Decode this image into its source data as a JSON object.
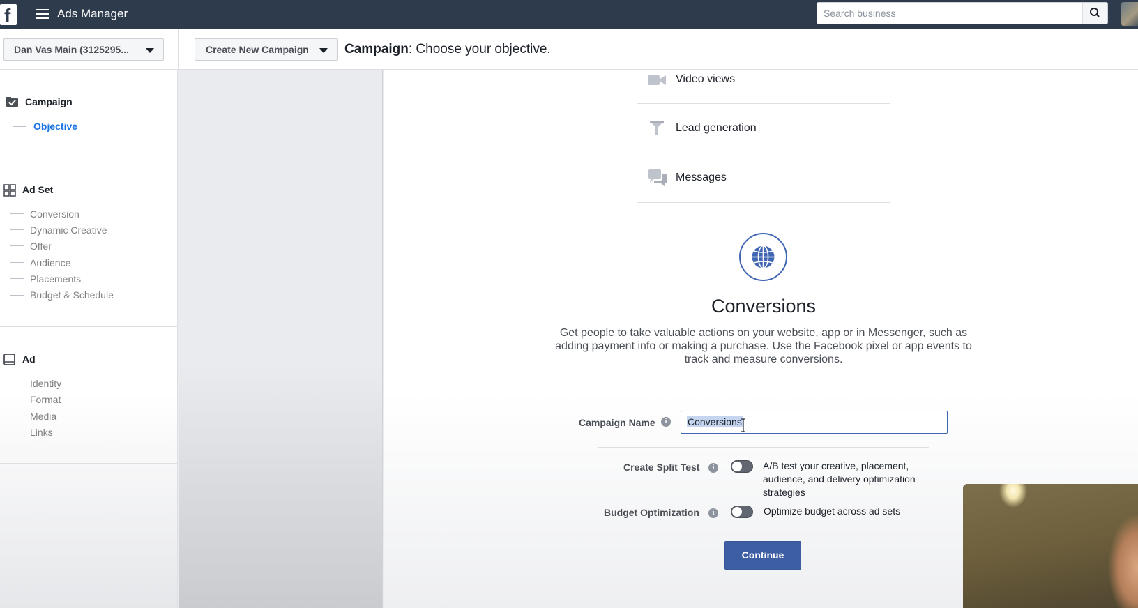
{
  "topbar": {
    "logo": "f",
    "app_title": "Ads Manager",
    "search_placeholder": "Search business"
  },
  "subheader": {
    "account": "Dan Vas Main (3125295...",
    "create_button": "Create New Campaign",
    "title_bold": "Campaign",
    "title_rest": ": Choose your objective."
  },
  "sidebar": {
    "campaign": {
      "title": "Campaign",
      "items": [
        "Objective"
      ]
    },
    "adset": {
      "title": "Ad Set",
      "items": [
        "Conversion",
        "Dynamic Creative",
        "Offer",
        "Audience",
        "Placements",
        "Budget & Schedule"
      ]
    },
    "ad": {
      "title": "Ad",
      "items": [
        "Identity",
        "Format",
        "Media",
        "Links"
      ]
    }
  },
  "objectives": [
    {
      "label": "Video views",
      "icon": "video-camera-icon"
    },
    {
      "label": "Lead generation",
      "icon": "funnel-icon"
    },
    {
      "label": "Messages",
      "icon": "chat-bubbles-icon"
    }
  ],
  "selected_objective": {
    "icon": "globe-icon",
    "title": "Conversions",
    "description": "Get people to take valuable actions on your website, app or in Messenger, such as adding payment info or making a purchase. Use the Facebook pixel or app events to track and measure conversions."
  },
  "form": {
    "campaign_name_label": "Campaign Name",
    "campaign_name_value": "Conversions",
    "split_test_label": "Create Split Test",
    "split_test_desc": "A/B test your creative, placement, audience, and delivery optimization strategies",
    "split_test_on": false,
    "budget_label": "Budget Optimization",
    "budget_desc": "Optimize budget across ad sets",
    "budget_on": false,
    "info_glyph": "i",
    "continue_label": "Continue"
  },
  "colors": {
    "topbar": "#2d3b4c",
    "accent": "#1b74e4",
    "button_primary": "#3e5ea3"
  }
}
